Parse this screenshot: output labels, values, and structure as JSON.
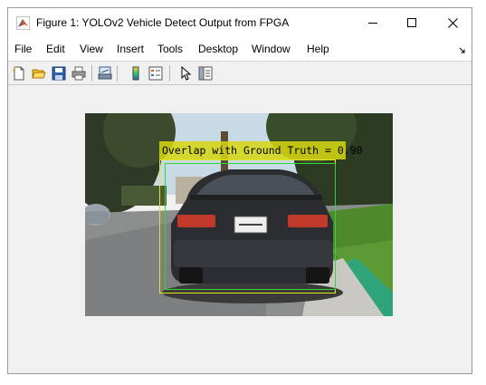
{
  "window": {
    "title": "Figure 1: YOLOv2 Vehicle Detect Output from FPGA"
  },
  "menubar": {
    "items": [
      "File",
      "Edit",
      "View",
      "Insert",
      "Tools",
      "Desktop",
      "Window",
      "Help"
    ]
  },
  "toolbar": {
    "buttons": [
      "new-figure-icon",
      "open-file-icon",
      "save-icon",
      "print-icon",
      "link-plot-icon",
      "insert-colorbar-icon",
      "insert-legend-icon",
      "select-arrow-icon",
      "property-inspector-icon"
    ]
  },
  "figure": {
    "annotation": "Overlap with Ground Truth = 0.90",
    "colors": {
      "detection_box": "#e6e61e",
      "ground_truth_box": "#35d435",
      "label_background": "#d6d610"
    }
  }
}
